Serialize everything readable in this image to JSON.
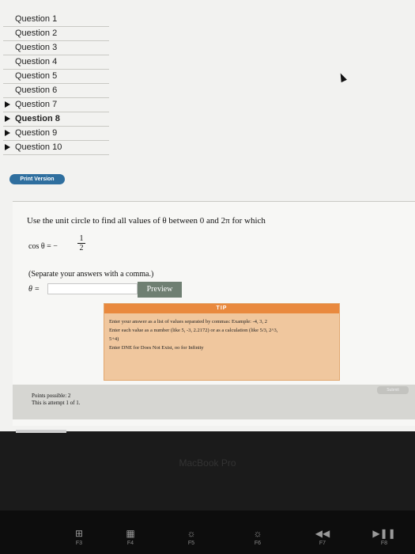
{
  "sidebar": {
    "items": [
      {
        "label": "Question 1",
        "arrow": false,
        "active": false
      },
      {
        "label": "Question 2",
        "arrow": false,
        "active": false
      },
      {
        "label": "Question 3",
        "arrow": false,
        "active": false
      },
      {
        "label": "Question 4",
        "arrow": false,
        "active": false
      },
      {
        "label": "Question 5",
        "arrow": false,
        "active": false
      },
      {
        "label": "Question 6",
        "arrow": false,
        "active": false
      },
      {
        "label": "Question 7",
        "arrow": true,
        "active": false
      },
      {
        "label": "Question 8",
        "arrow": true,
        "active": true
      },
      {
        "label": "Question 9",
        "arrow": true,
        "active": false
      },
      {
        "label": "Question 10",
        "arrow": true,
        "active": false
      }
    ],
    "print_label": "Print Version"
  },
  "problem": {
    "prompt": "Use the unit circle to find all values of θ between 0 and 2π for which",
    "equation_lhs": "cos θ = −",
    "frac_num": "1",
    "frac_den": "2",
    "note": "(Separate your answers with a comma.)",
    "answer_label": "θ =",
    "answer_value": "",
    "preview_label": "Preview"
  },
  "tip": {
    "header": "TIP",
    "lines": [
      "Enter your answer as a list of values separated by commas: Example: -4, 3, 2",
      "Enter each value as a number (like 5, -3, 2.2172) or as a calculation (like 5/3, 2^3,",
      "5+4)",
      "Enter DNE for Does Not Exist, oo for Infinity"
    ]
  },
  "status": {
    "points": "Points possible: 2",
    "attempt": "This is attempt 1 of 1.",
    "submit_label": "Submit"
  },
  "device": {
    "brand": "MacBook Pro",
    "keys": [
      {
        "glyph": "⊞",
        "label": "F3"
      },
      {
        "glyph": "▦",
        "label": "F4"
      },
      {
        "glyph": "☼",
        "label": "F5"
      },
      {
        "glyph": "☼",
        "label": "F6"
      },
      {
        "glyph": "◀◀",
        "label": "F7"
      },
      {
        "glyph": "▶❚❚",
        "label": "F8"
      }
    ]
  },
  "colors": {
    "print_button": "#2f6f9f",
    "preview_button": "#6f7f72",
    "tip_header": "#e9893e",
    "tip_body": "#f0c79e"
  }
}
